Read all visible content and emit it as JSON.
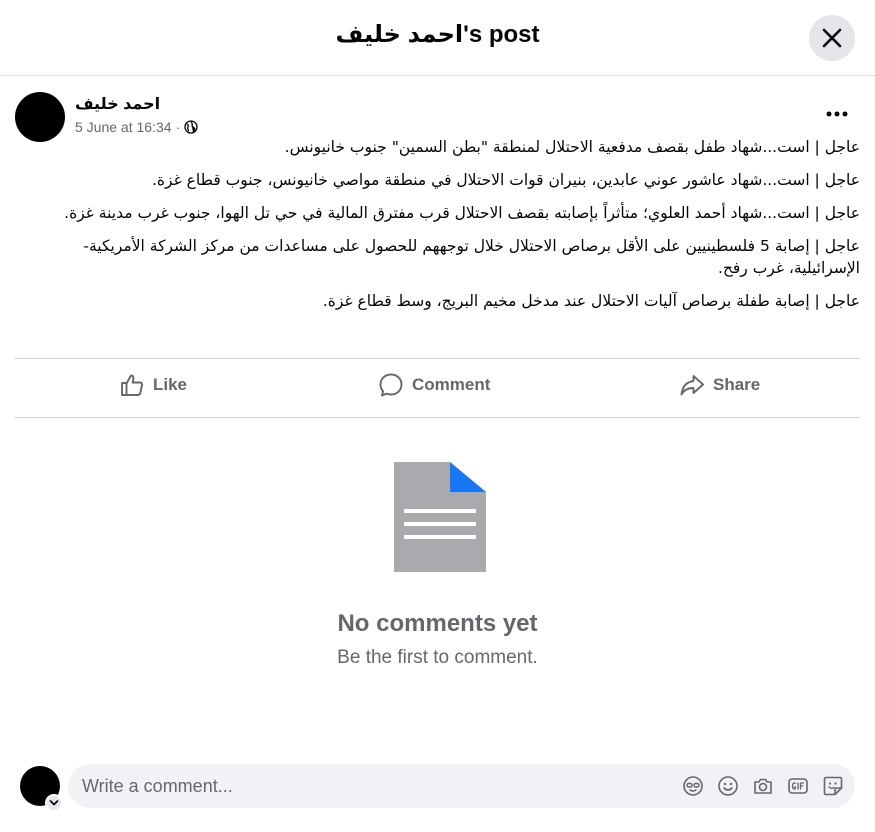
{
  "dialog": {
    "title": "احمد خليف's post"
  },
  "post": {
    "author": "احمد خليف",
    "timestamp": "5 June at 16:34",
    "separator": "·",
    "privacy_icon": "globe-icon",
    "paragraphs": [
      "عاجل | است...شهاد طفل بقصف مدفعية الاحتلال لمنطقة \"بطن السمين\" جنوب خانيونس.",
      "عاجل | است...شهاد عاشور عوني عابدين، بنيران قوات الاحتلال في منطقة مواصي خانيونس، جنوب قطاع غزة.",
      "عاجل | است...شهاد أحمد العلوي؛ متأثراً بإصابته بقصف الاحتلال قرب مفترق المالية في حي تل الهوا، جنوب غرب مدينة غزة.",
      "عاجل | إصابة 5 فلسطينيين على الأقل برصاص الاحتلال خلال توجههم للحصول على مساعدات من مركز الشركة الأمريكية- الإسرائيلية، غرب رفح.",
      "عاجل | إصابة طفلة برصاص آليات الاحتلال عند مدخل مخيم البريج، وسط قطاع غزة."
    ]
  },
  "actions": {
    "like": "Like",
    "comment": "Comment",
    "share": "Share"
  },
  "empty_state": {
    "title": "No comments yet",
    "subtitle": "Be the first to comment."
  },
  "composer": {
    "placeholder": "Write a comment...",
    "icons": [
      "avatar-sticker-icon",
      "emoji-icon",
      "camera-icon",
      "gif-icon",
      "sticker-icon"
    ]
  },
  "colors": {
    "text_primary": "#050505",
    "text_secondary": "#65676b",
    "divider": "#ced0d4",
    "button_bg": "#e4e6eb",
    "input_bg": "#f0f2f5",
    "doc_icon_gray": "#a8aaad",
    "doc_icon_accent": "#1877f2"
  }
}
